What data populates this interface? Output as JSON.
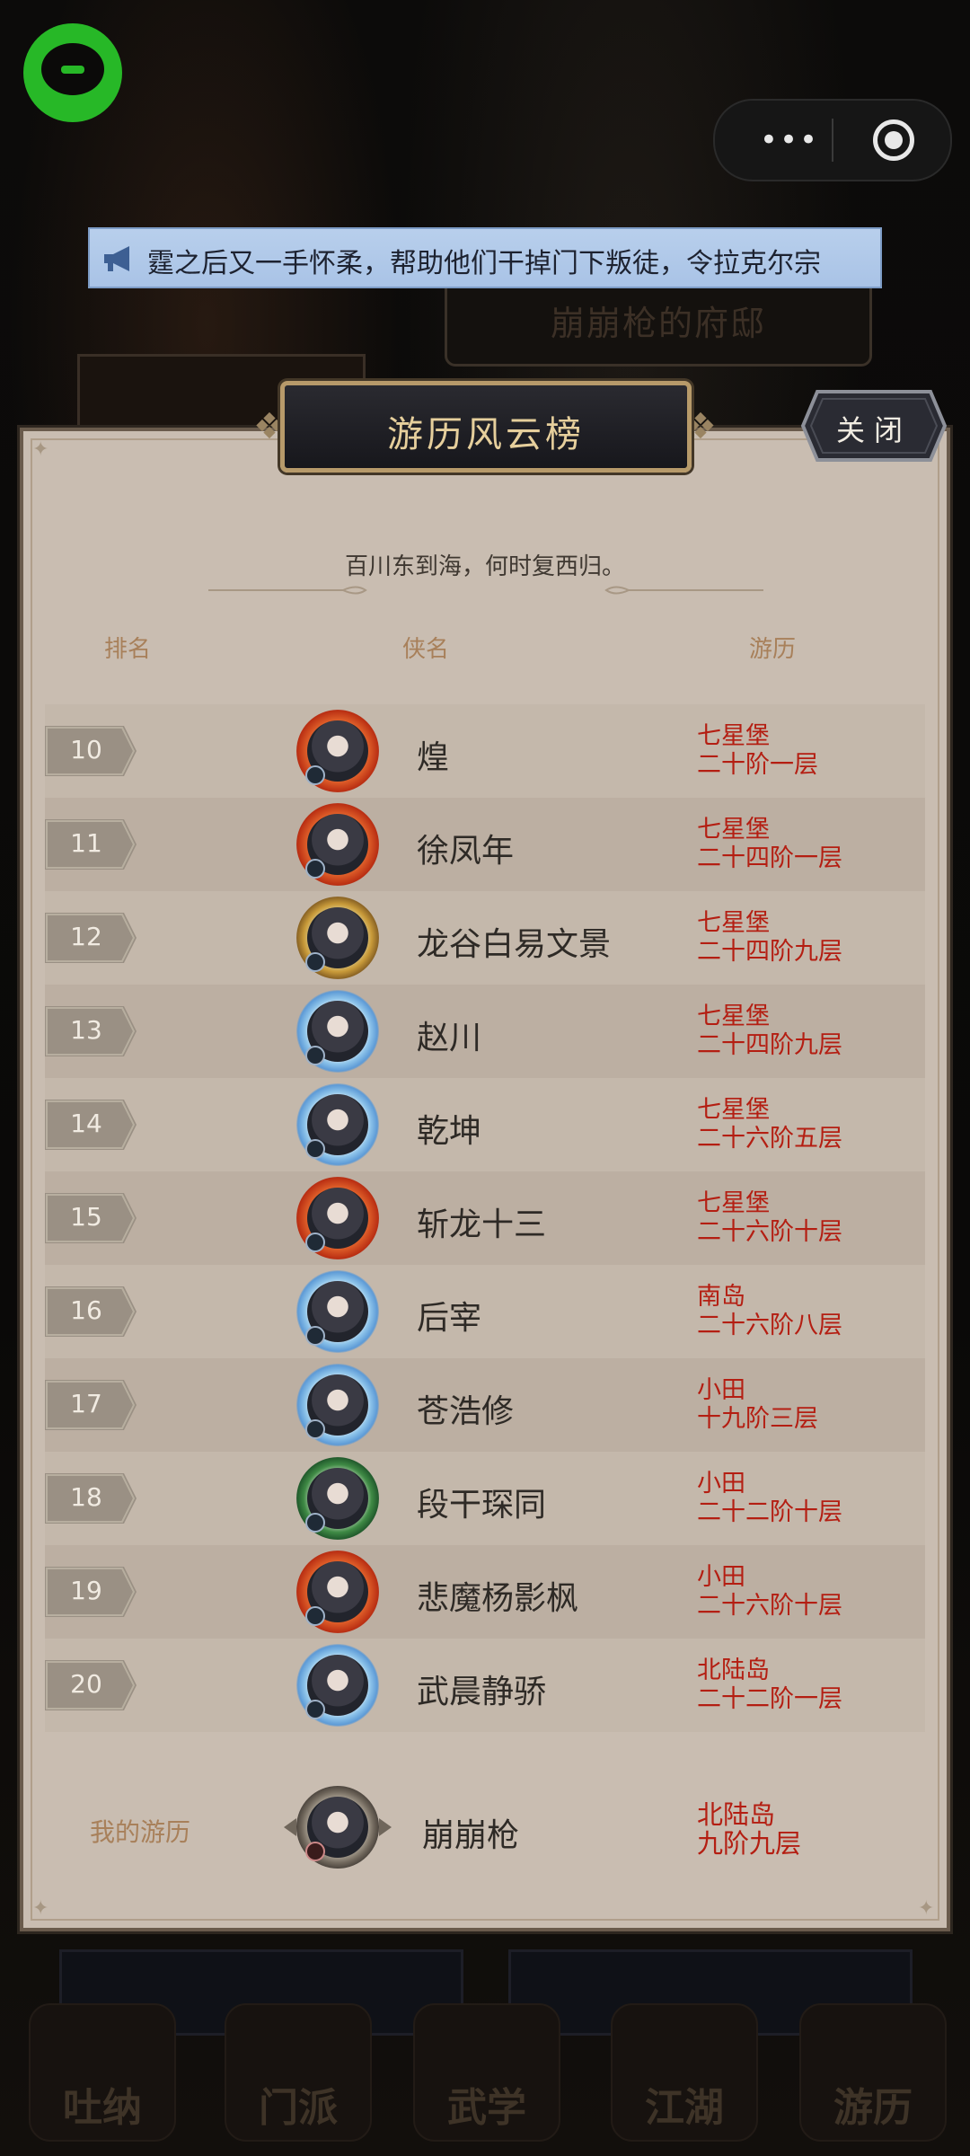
{
  "marquee": {
    "text": "霆之后又一手怀柔，帮助他们干掉门下叛徒，令拉克尔宗"
  },
  "capsule": {
    "more_label": "•••",
    "more_icon": "more-dots-icon",
    "close_icon": "target-circle-icon"
  },
  "background": {
    "banner_text": "崩崩枪的府邸",
    "tabs": [
      "吐纳",
      "门派",
      "武学",
      "江湖",
      "游历"
    ]
  },
  "panel": {
    "title": "游历风云榜",
    "close_label": "关闭",
    "subtitle": "百川东到海，何时复西归。",
    "columns": {
      "rank": "排名",
      "name": "侠名",
      "journey": "游历"
    }
  },
  "rows": [
    {
      "rank": "10",
      "name": "煌",
      "loc_line1": "七星堡",
      "loc_line2": "二十阶一层",
      "frame": "fire"
    },
    {
      "rank": "11",
      "name": "徐凤年",
      "loc_line1": "七星堡",
      "loc_line2": "二十四阶一层",
      "frame": "fire"
    },
    {
      "rank": "12",
      "name": "龙谷白易文景",
      "loc_line1": "七星堡",
      "loc_line2": "二十四阶九层",
      "frame": "gold"
    },
    {
      "rank": "13",
      "name": "赵川",
      "loc_line1": "七星堡",
      "loc_line2": "二十四阶九层",
      "frame": "ice"
    },
    {
      "rank": "14",
      "name": "乾坤",
      "loc_line1": "七星堡",
      "loc_line2": "二十六阶五层",
      "frame": "ice"
    },
    {
      "rank": "15",
      "name": "斩龙十三",
      "loc_line1": "七星堡",
      "loc_line2": "二十六阶十层",
      "frame": "fire"
    },
    {
      "rank": "16",
      "name": "后宰",
      "loc_line1": "南岛",
      "loc_line2": "二十六阶八层",
      "frame": "ice"
    },
    {
      "rank": "17",
      "name": "苍浩修",
      "loc_line1": "小田",
      "loc_line2": "十九阶三层",
      "frame": "ice"
    },
    {
      "rank": "18",
      "name": "段干琛同",
      "loc_line1": "小田",
      "loc_line2": "二十二阶十层",
      "frame": "jade"
    },
    {
      "rank": "19",
      "name": "悲魔杨影枫",
      "loc_line1": "小田",
      "loc_line2": "二十六阶十层",
      "frame": "fire"
    },
    {
      "rank": "20",
      "name": "武晨静骄",
      "loc_line1": "北陆岛",
      "loc_line2": "二十二阶一层",
      "frame": "ice"
    }
  ],
  "mine": {
    "label": "我的游历",
    "name": "崩崩枪",
    "loc_line1": "北陆岛",
    "loc_line2": "九阶九层"
  }
}
